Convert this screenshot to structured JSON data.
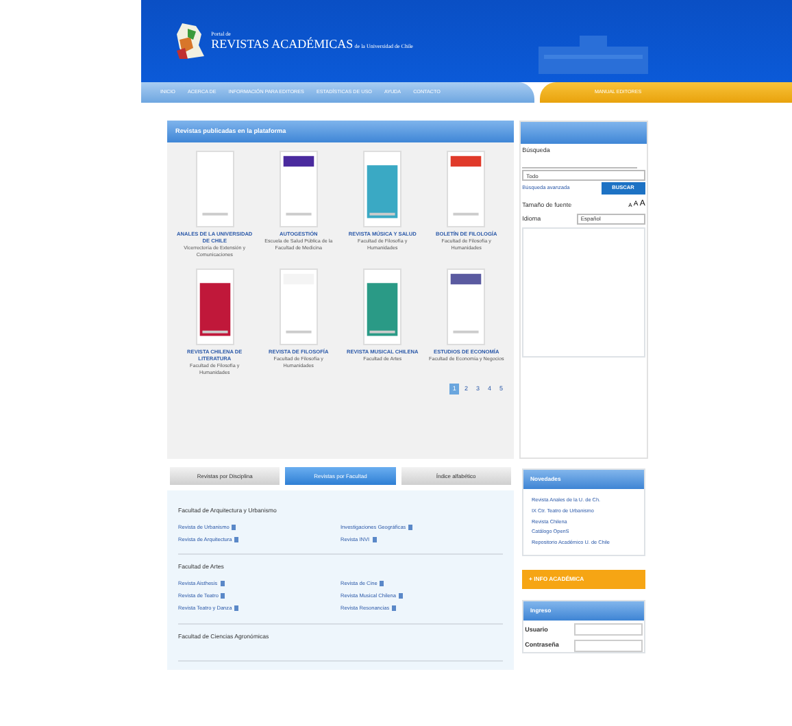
{
  "header": {
    "kicker": "Portal de",
    "title": "REVISTAS ACADÉMICAS",
    "subtitle": "de la Universidad de Chile"
  },
  "nav": [
    {
      "label": "INICIO"
    },
    {
      "label": "ACERCA DE"
    },
    {
      "label": "INFORMACIÓN PARA EDITORES"
    },
    {
      "label": "ESTADÍSTICAS DE USO"
    },
    {
      "label": "AYUDA"
    },
    {
      "label": "CONTACTO"
    }
  ],
  "nav_highlight": "MANUAL EDITORES",
  "featured": {
    "title": "Revistas publicadas en la plataforma",
    "journals": [
      {
        "title": "ANALES DE LA UNIVERSIDAD DE CHILE",
        "publisher": "Vicerrectoría de Extensión y Comunicaciones",
        "color": "#ffffff"
      },
      {
        "title": "AUTOGESTIÓN",
        "publisher": "Escuela de Salud Pública de la Facultad de Medicina",
        "color": "#4a2a9e"
      },
      {
        "title": "REVISTA MÚSICA Y SALUD",
        "publisher": "Facultad de Filosofía y Humanidades",
        "color": "#3aa9c4"
      },
      {
        "title": "BOLETÍN DE FILOLOGÍA",
        "publisher": "Facultad de Filosofía y Humanidades",
        "color": "#e03a2a"
      },
      {
        "title": "REVISTA CHILENA DE LITERATURA",
        "publisher": "Facultad de Filosofía y Humanidades",
        "color": "#c0183a"
      },
      {
        "title": "REVISTA DE FILOSOFÍA",
        "publisher": "Facultad de Filosofía y Humanidades",
        "color": "#f4f4f4"
      },
      {
        "title": "REVISTA MUSICAL CHILENA",
        "publisher": "Facultad de Artes",
        "color": "#2a9a86"
      },
      {
        "title": "ESTUDIOS DE ECONOMÍA",
        "publisher": "Facultad de Economía y Negocios",
        "color": "#5a5aa0"
      }
    ],
    "pages": [
      {
        "label": "1",
        "selected": true
      },
      {
        "label": "2",
        "selected": false
      },
      {
        "label": "3",
        "selected": false
      },
      {
        "label": "4",
        "selected": false
      },
      {
        "label": "5",
        "selected": false
      }
    ]
  },
  "search": {
    "label": "Búsqueda",
    "scope": "Todo",
    "advanced": "Búsqueda avanzada",
    "button": "BUSCAR",
    "font_size_label": "Tamaño de fuente",
    "font_sizes": [
      "A",
      "A",
      "A"
    ],
    "language_label": "Idioma",
    "language": "Español"
  },
  "tabs": [
    {
      "label": "Revistas por Disciplina",
      "selected": false
    },
    {
      "label": "Revistas por Facultad",
      "selected": true
    },
    {
      "label": "Índice alfabético",
      "selected": false
    }
  ],
  "faculties": [
    {
      "name": "Facultad de Arquitectura y Urbanismo",
      "journals": [
        "Revista de Urbanismo",
        "Investigaciones Geográficas",
        "Revista de Arquitectura",
        "Revista INVI"
      ]
    },
    {
      "name": "Facultad de Artes",
      "journals": [
        "Revista Aisthesis",
        "Revista de Cine",
        "Revista de Teatro",
        "Revista Musical Chilena",
        "Revista Teatro y Danza",
        "Revista Resonancias"
      ]
    },
    {
      "name": "Facultad de Ciencias Agronómicas"
    }
  ],
  "news": {
    "title": "Novedades",
    "items": [
      "Revista Anales de la U. de Ch.",
      "IX Ctr. Teatro de Urbanismo",
      "Revista Chilena",
      "Catálogo OpenS",
      "Repositorio Académico U. de Chile"
    ]
  },
  "info_banner": "+ INFO ACADÉMICA",
  "login": {
    "title": "Ingreso",
    "user_label": "Usuario",
    "password_label": "Contraseña"
  }
}
